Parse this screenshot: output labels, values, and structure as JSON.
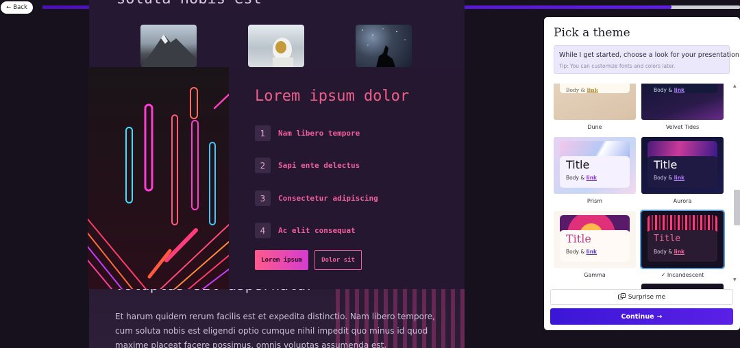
{
  "nav": {
    "back_label": "Back",
    "progress": 0.902
  },
  "slide": {
    "top_heading": "soluta nobis est",
    "card_title": "Lorem ipsum dolor",
    "items": [
      {
        "num": "1",
        "text": "Nam libero tempore"
      },
      {
        "num": "2",
        "text": "Sapi ente delectus"
      },
      {
        "num": "3",
        "text": "Consectetur adipiscing"
      },
      {
        "num": "4",
        "text": "Ac elit consequat"
      }
    ],
    "primary_btn": "Lorem ipsum",
    "outline_btn": "Dolor sit",
    "bottom_heading": "Voluptas sit aspernatur",
    "bottom_para": "Et harum quidem rerum facilis est et expedita distinctio. Nam libero tempore, cum soluta nobis est eligendi optio cumque nihil impedit quo minus id quod maxime placeat facere possimus, omnis voluptas assumenda est."
  },
  "panel": {
    "title": "Pick a theme",
    "intro": "While I get started, choose a look for your presentation.",
    "tip": "Tip: You can customize fonts and colors later.",
    "preview_title": "Title",
    "preview_body": "Body &",
    "preview_link": "link",
    "themes": [
      {
        "name": "Dune",
        "selected": false
      },
      {
        "name": "Velvet Tides",
        "selected": false
      },
      {
        "name": "Prism",
        "selected": false
      },
      {
        "name": "Aurora",
        "selected": false
      },
      {
        "name": "Gamma",
        "selected": false
      },
      {
        "name": "Incandescent",
        "selected": true,
        "check": "✓"
      }
    ],
    "surprise_label": "Surprise me",
    "continue_label": "Continue",
    "continue_arrow": "→",
    "colors": {
      "accent": "#3b16d6",
      "selected_outline": "#5a9ddb",
      "slide_pink": "#f05f8c"
    }
  }
}
